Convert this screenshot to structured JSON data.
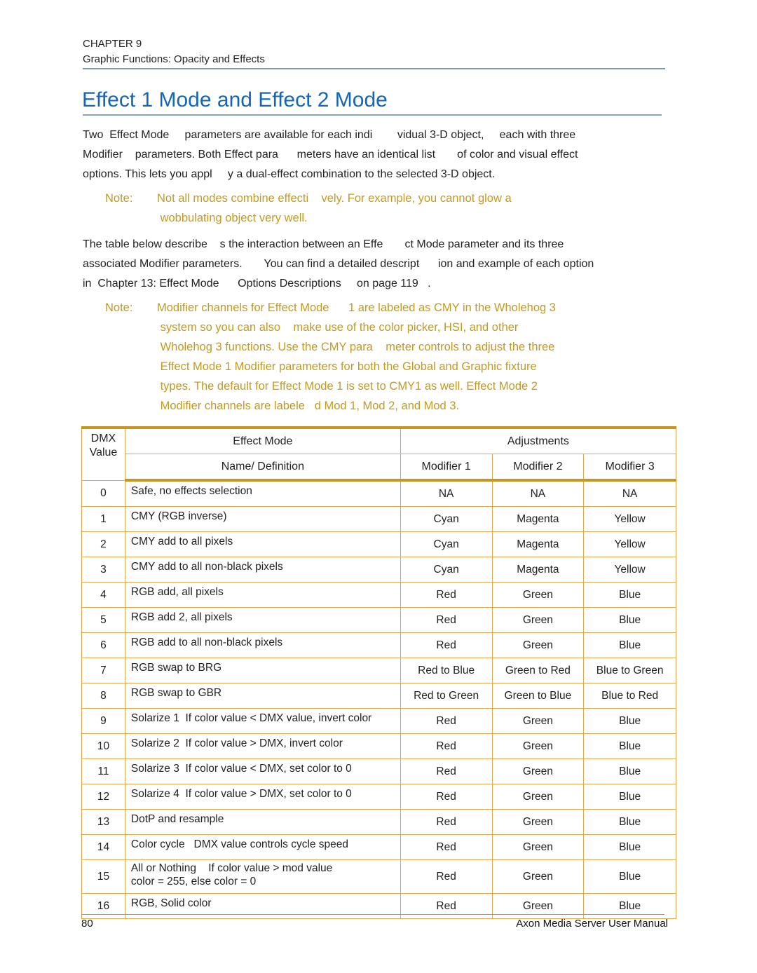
{
  "header": {
    "chapter": "CHAPTER 9",
    "chapter_title": "Graphic Functions: Opacity and Effects"
  },
  "title": "Effect 1 Mode and Effect 2 Mode",
  "colors": {
    "title_blue": "#1466b8",
    "note_gold": "#c49a1c",
    "table_border": "#e0a84a",
    "table_heavy_border": "#c9951e",
    "rule_blue": "#7a9bb5"
  },
  "paragraphs": {
    "intro": [
      "Two  Effect Mode     parameters are available for each indi        vidual 3-D object,     each with three",
      "Modifier    parameters. Both Effect para      meters have an identical list       of color and visual effect",
      "options. This lets you appl     y a dual-effect combination to the selected 3-D object."
    ],
    "table_intro": [
      "The table below describe    s the interaction between an Effe       ct Mode parameter and its three",
      "associated Modifier parameters.       You can find a detailed descript      ion and example of each option",
      "in  Chapter 13: Effect Mode      Options Descriptions     on page 119   ."
    ]
  },
  "notes": [
    {
      "label": "Note:",
      "lines": [
        "Not all modes combine effecti    vely. For example, you cannot glow a",
        " wobbulating object very well."
      ]
    },
    {
      "label": "Note:",
      "lines": [
        "Modifier channels for Effect Mode      1 are labeled as CMY in the Wholehog 3",
        " system so you can also    make use of the color picker, HSI, and other",
        " Wholehog 3 functions. Use the CMY para    meter controls to adjust the three",
        " Effect Mode 1 Modifier parameters for both the Global and Graphic fixture",
        " types. The default for Effect Mode 1 is set to CMY1 as well. Effect Mode 2",
        " Modifier channels are labele   d Mod 1, Mod 2, and Mod 3."
      ]
    }
  ],
  "table": {
    "header": {
      "dmx_line1": "DMX",
      "dmx_line2": "Value",
      "effect_mode": "Effect Mode",
      "name_definition": "Name/ Definition",
      "adjustments": "Adjustments",
      "modifier1": "Modifier 1",
      "modifier2": "Modifier 2",
      "modifier3": "Modifier 3"
    },
    "rows": [
      {
        "dmx": "0",
        "name": "Safe, no effects selection",
        "name2": "",
        "m1": "NA",
        "m2": "NA",
        "m3": "NA"
      },
      {
        "dmx": "1",
        "name": "CMY (RGB inverse)",
        "name2": "",
        "m1": "Cyan",
        "m2": "Magenta",
        "m3": "Yellow"
      },
      {
        "dmx": "2",
        "name": "CMY add to all pixels",
        "name2": "",
        "m1": "Cyan",
        "m2": "Magenta",
        "m3": "Yellow"
      },
      {
        "dmx": "3",
        "name": "CMY add to all non-black pixels",
        "name2": "",
        "m1": "Cyan",
        "m2": "Magenta",
        "m3": "Yellow"
      },
      {
        "dmx": "4",
        "name": "RGB add, all pixels",
        "name2": "",
        "m1": "Red",
        "m2": "Green",
        "m3": "Blue"
      },
      {
        "dmx": "5",
        "name": "RGB add 2, all pixels",
        "name2": "",
        "m1": "Red",
        "m2": "Green",
        "m3": "Blue"
      },
      {
        "dmx": "6",
        "name": "RGB add to all non-black pixels",
        "name2": "",
        "m1": "Red",
        "m2": "Green",
        "m3": "Blue"
      },
      {
        "dmx": "7",
        "name": "RGB swap to BRG",
        "name2": "",
        "m1": "Red to Blue",
        "m2": "Green to Red",
        "m3": "Blue to Green"
      },
      {
        "dmx": "8",
        "name": "RGB swap to GBR",
        "name2": "",
        "m1": "Red to Green",
        "m2": "Green to Blue",
        "m3": "Blue to Red"
      },
      {
        "dmx": "9",
        "name": "Solarize 1  If color value < DMX value, invert color",
        "name2": "",
        "m1": "Red",
        "m2": "Green",
        "m3": "Blue"
      },
      {
        "dmx": "10",
        "name": "Solarize 2  If color value > DMX, invert color",
        "name2": "",
        "m1": "Red",
        "m2": "Green",
        "m3": "Blue"
      },
      {
        "dmx": "11",
        "name": "Solarize 3  If color value < DMX, set color to 0",
        "name2": "",
        "m1": "Red",
        "m2": "Green",
        "m3": "Blue"
      },
      {
        "dmx": "12",
        "name": "Solarize 4  If color value > DMX, set color to 0",
        "name2": "",
        "m1": "Red",
        "m2": "Green",
        "m3": "Blue"
      },
      {
        "dmx": "13",
        "name": "DotP and resample",
        "name2": "",
        "m1": "Red",
        "m2": "Green",
        "m3": "Blue"
      },
      {
        "dmx": "14",
        "name": "Color cycle   DMX value controls cycle speed",
        "name2": "",
        "m1": "Red",
        "m2": "Green",
        "m3": "Blue"
      },
      {
        "dmx": "15",
        "name": "All or Nothing    If color value > mod value",
        "name2": "color = 255, else color = 0",
        "m1": "Red",
        "m2": "Green",
        "m3": "Blue"
      },
      {
        "dmx": "16",
        "name": "RGB, Solid color",
        "name2": "",
        "m1": "Red",
        "m2": "Green",
        "m3": "Blue"
      }
    ]
  },
  "footer": {
    "page_number": "80",
    "manual_title": "Axon Media Server User Manual"
  }
}
